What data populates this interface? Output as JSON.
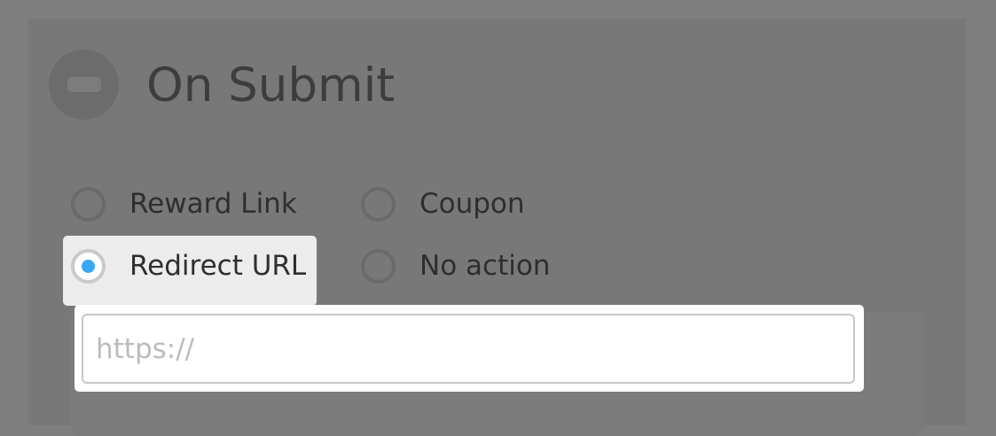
{
  "section": {
    "title": "On Submit",
    "collapse_icon": "minus-circle-icon"
  },
  "actions": {
    "options": [
      {
        "label": "Reward Link",
        "selected": false
      },
      {
        "label": "Coupon",
        "selected": false
      },
      {
        "label": "Redirect URL",
        "selected": true
      },
      {
        "label": "No action",
        "selected": false
      }
    ]
  },
  "redirect": {
    "url_value": "",
    "url_placeholder": "https://"
  },
  "colors": {
    "accent": "#39a6f6",
    "overlay": "#7f7f7f"
  }
}
